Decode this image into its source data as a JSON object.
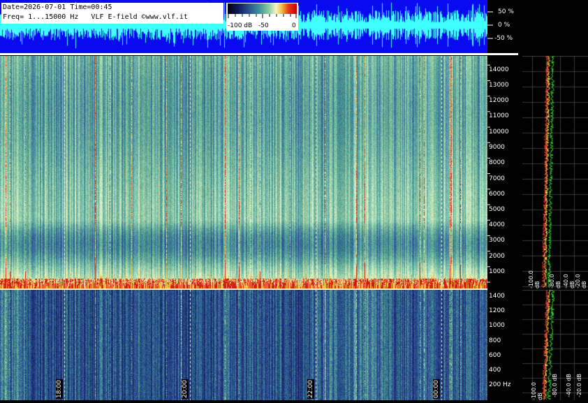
{
  "header": {
    "line1": "Date=2026-07-01 Time=00:45",
    "line2": "Freq= 1...15000 Hz   VLF E-field ©www.vlf.it"
  },
  "colorbar": {
    "label_low": "-100 dB",
    "label_mid": "-50",
    "label_high": "0"
  },
  "amplitude_axis": [
    "50 %",
    "0 %",
    "-50 %"
  ],
  "upper_freq_axis": [
    "14000",
    "13000",
    "12000",
    "11000",
    "10000",
    "9000",
    "8000",
    "7000",
    "6000",
    "5000",
    "4000",
    "3000",
    "2000",
    "1000"
  ],
  "lower_freq_axis": [
    "1400",
    "1200",
    "1000",
    "800",
    "600",
    "400",
    "200 Hz"
  ],
  "time_labels": [
    "18:00",
    "20:00",
    "22:00",
    "00:00"
  ],
  "spectrum_db_labels_upper": [
    "-100.0 dB",
    "-80.0 dB",
    "-40.0 dB",
    "-20.0 dB"
  ],
  "spectrum_db_labels_lower": [
    "-100.0 dB",
    "-80.0 dB",
    "-40.0 dB",
    "-20.0 dB"
  ],
  "colors": {
    "wave_bg": "#0a0af0",
    "wave_trace": "#40ffff",
    "spec_low": "#1c2a78",
    "spec_mid": "#5fae98",
    "spec_high": "#d6f0c8",
    "sferic_red": "#d21e10",
    "spectrum_yellow": "#ffff40",
    "spectrum_green": "#30e030",
    "spectrum_red": "#ff3030"
  }
}
